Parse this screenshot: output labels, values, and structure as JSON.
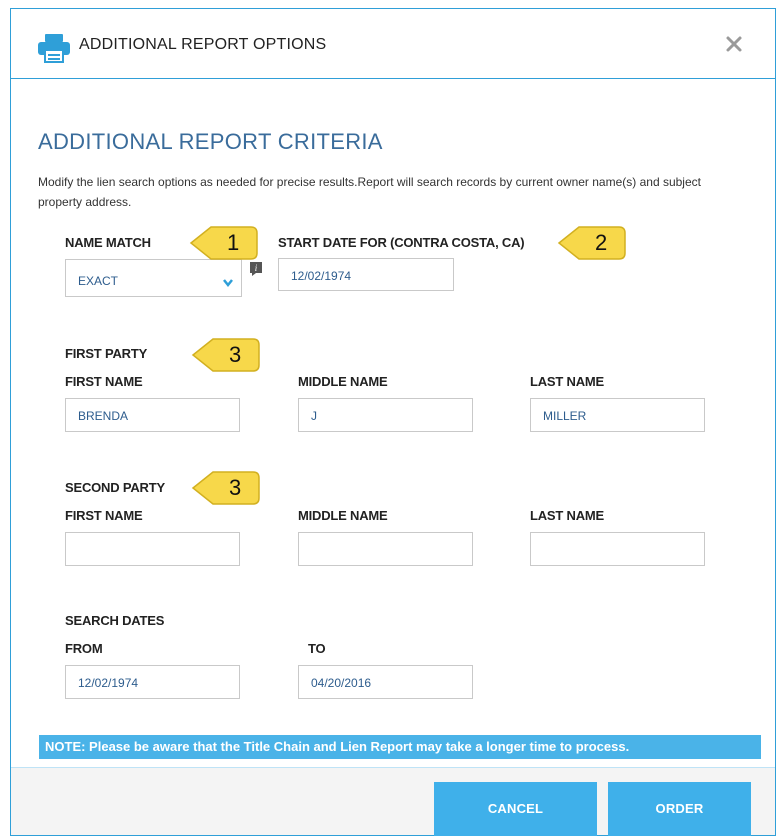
{
  "header": {
    "title": "ADDITIONAL REPORT OPTIONS",
    "icon": "printer-icon",
    "close_icon": "close-icon"
  },
  "section": {
    "title": "ADDITIONAL REPORT CRITERIA",
    "description": "Modify the lien search options as needed for precise results.Report will search records by current owner name(s) and subject property address."
  },
  "name_match": {
    "label": "NAME MATCH",
    "value": "EXACT"
  },
  "start_date": {
    "label": "START DATE FOR (CONTRA COSTA, CA)",
    "value": "12/02/1974"
  },
  "first_party": {
    "title": "FIRST PARTY",
    "first_name_label": "FIRST NAME",
    "middle_name_label": "MIDDLE NAME",
    "last_name_label": "LAST NAME",
    "first_name": "BRENDA",
    "middle_name": "J",
    "last_name": "MILLER"
  },
  "second_party": {
    "title": "SECOND PARTY",
    "first_name_label": "FIRST NAME",
    "middle_name_label": "MIDDLE NAME",
    "last_name_label": "LAST NAME",
    "first_name": "",
    "middle_name": "",
    "last_name": ""
  },
  "search_dates": {
    "title": "SEARCH DATES",
    "from_label": "FROM",
    "to_label": "TO",
    "from": "12/02/1974",
    "to": "04/20/2016"
  },
  "callouts": [
    "1",
    "2",
    "3",
    "3"
  ],
  "note": "NOTE: Please be aware that the Title Chain and Lien Report may take a longer time to process.",
  "footer": {
    "cancel": "CANCEL",
    "order": "ORDER"
  },
  "colors": {
    "accent": "#3fb0ea",
    "callout": "#f7d84a",
    "title_blue": "#3a6c9b"
  }
}
